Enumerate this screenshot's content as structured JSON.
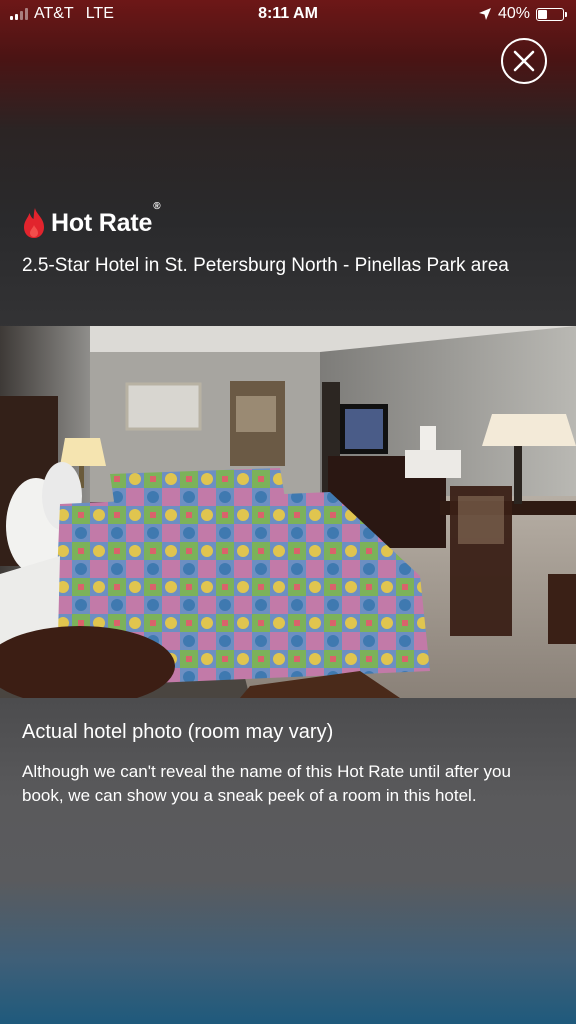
{
  "status_bar": {
    "carrier": "AT&T",
    "network": "LTE",
    "time": "8:11 AM",
    "battery": "40%",
    "battery_level": 0.4,
    "signal_bars": 2,
    "signal_total": 4
  },
  "brand": {
    "name": "Hot Rate",
    "mark": "®",
    "icon": "flame-icon",
    "color": "#e2242d"
  },
  "hotel": {
    "description": "2.5-Star Hotel in St. Petersburg North - Pinellas Park area"
  },
  "photo": {
    "caption": "Actual hotel photo (room may vary)",
    "note": "Although we can't reveal the name of this Hot Rate until after you book, we can show you a sneak peek of a room in this hotel."
  },
  "close": {
    "icon": "close-icon"
  }
}
